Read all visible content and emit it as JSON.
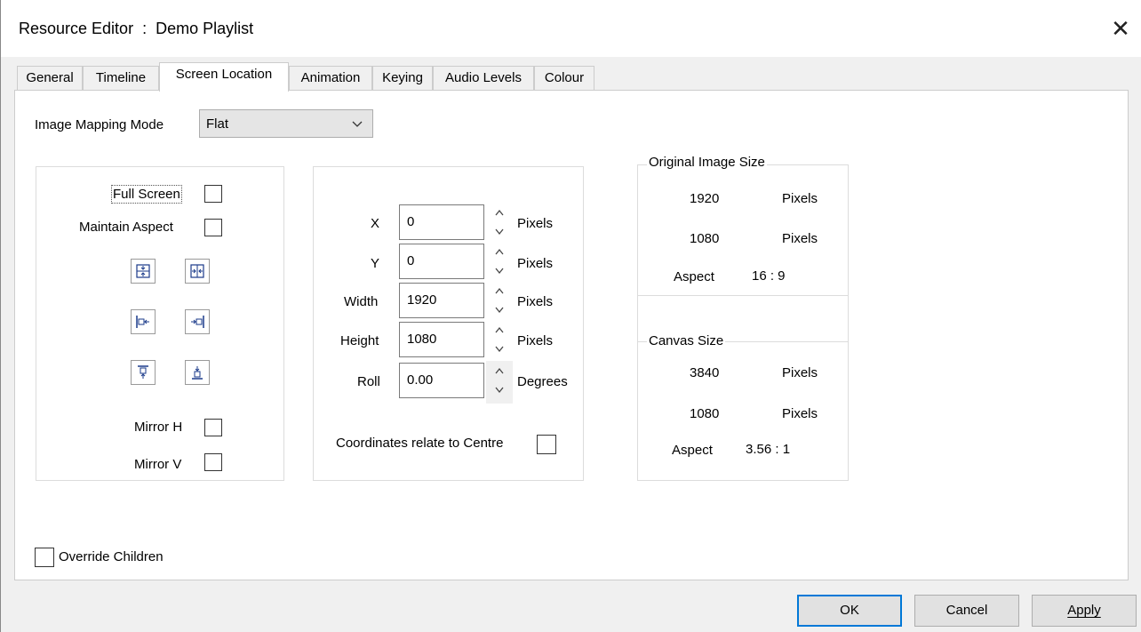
{
  "window": {
    "title_prefix": "Resource Editor",
    "title_sep": ":",
    "title_name": "Demo Playlist",
    "close_glyph": "✕"
  },
  "tabs": [
    {
      "label": "General"
    },
    {
      "label": "Timeline"
    },
    {
      "label": "Screen Location",
      "active": true
    },
    {
      "label": "Animation"
    },
    {
      "label": "Keying"
    },
    {
      "label": "Audio Levels"
    },
    {
      "label": "Colour"
    }
  ],
  "mapping": {
    "label": "Image Mapping Mode",
    "value": "Flat"
  },
  "left_group": {
    "full_screen": {
      "label": "Full Screen",
      "checked": false
    },
    "maintain_aspect": {
      "label": "Maintain Aspect",
      "checked": false
    },
    "align_icons": [
      "center-vertical-icon",
      "center-horizontal-icon",
      "align-left-icon",
      "align-right-icon",
      "align-top-icon",
      "align-bottom-icon"
    ],
    "mirror_h": {
      "label": "Mirror H",
      "checked": false
    },
    "mirror_v": {
      "label": "Mirror V",
      "checked": false
    }
  },
  "position": {
    "x": {
      "label": "X",
      "value": "0",
      "unit": "Pixels"
    },
    "y": {
      "label": "Y",
      "value": "0",
      "unit": "Pixels"
    },
    "width": {
      "label": "Width",
      "value": "1920",
      "unit": "Pixels"
    },
    "height": {
      "label": "Height",
      "value": "1080",
      "unit": "Pixels"
    },
    "roll": {
      "label": "Roll",
      "value": "0.00",
      "unit": "Degrees"
    },
    "centre": {
      "label": "Coordinates relate to Centre",
      "checked": false
    }
  },
  "original": {
    "legend": "Original Image Size",
    "width": "1920",
    "height": "1080",
    "unit": "Pixels",
    "aspect_label": "Aspect",
    "aspect_value": "16 : 9"
  },
  "canvas": {
    "legend": "Canvas Size",
    "width": "3840",
    "height": "1080",
    "unit": "Pixels",
    "aspect_label": "Aspect",
    "aspect_value": "3.56 : 1"
  },
  "override": {
    "label": "Override Children",
    "checked": false
  },
  "buttons": {
    "ok": "OK",
    "cancel": "Cancel",
    "apply": "Apply"
  },
  "colors": {
    "dialog_bg": "#f0f0f0",
    "default_border": "#0078d7"
  }
}
